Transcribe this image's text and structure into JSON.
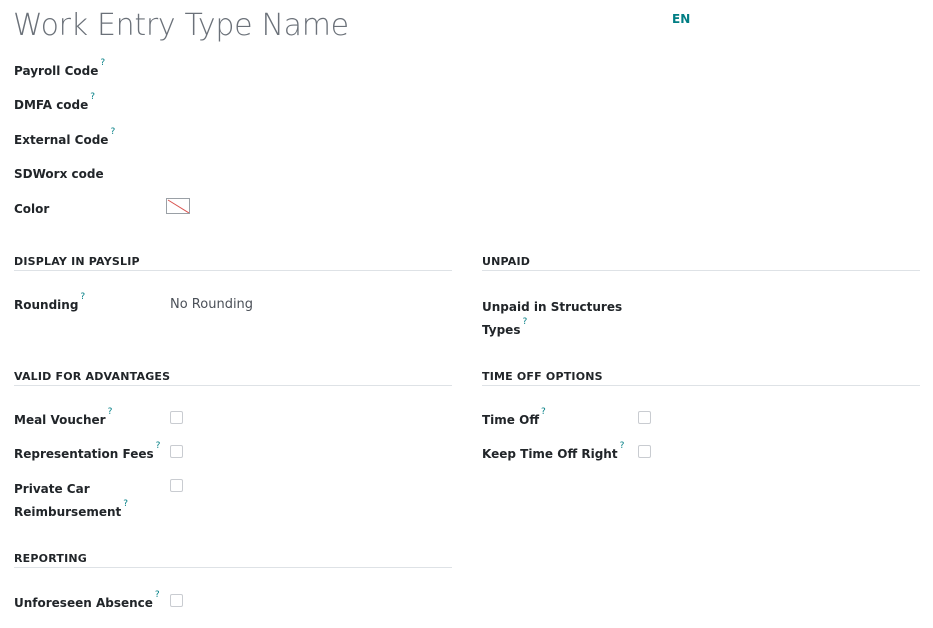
{
  "header": {
    "title": "Work Entry Type Name",
    "language": "EN"
  },
  "help_marker": "?",
  "top_fields": {
    "payroll_code": "Payroll Code",
    "dmfa_code": "DMFA code",
    "external_code": "External Code",
    "sdworx_code": "SDWorx code",
    "color": "Color"
  },
  "display_in_payslip": {
    "title": "DISPLAY IN PAYSLIP",
    "rounding_label": "Rounding",
    "rounding_value": "No Rounding"
  },
  "unpaid": {
    "title": "UNPAID",
    "structures_label_line1": "Unpaid in Structures",
    "structures_label_line2": "Types"
  },
  "valid_for_advantages": {
    "title": "VALID FOR ADVANTAGES",
    "meal_voucher": "Meal Voucher",
    "representation_fees": "Representation Fees",
    "private_car_line1": "Private Car",
    "private_car_line2": "Reimbursement"
  },
  "time_off_options": {
    "title": "TIME OFF OPTIONS",
    "time_off": "Time Off",
    "keep_time_off_right": "Keep Time Off Right"
  },
  "reporting": {
    "title": "REPORTING",
    "unforeseen_absence": "Unforeseen Absence"
  },
  "colors": {
    "accent": "#017e84",
    "title": "#6b7179",
    "rule": "#dee2e6",
    "swatch_slash": "#d9534f"
  }
}
